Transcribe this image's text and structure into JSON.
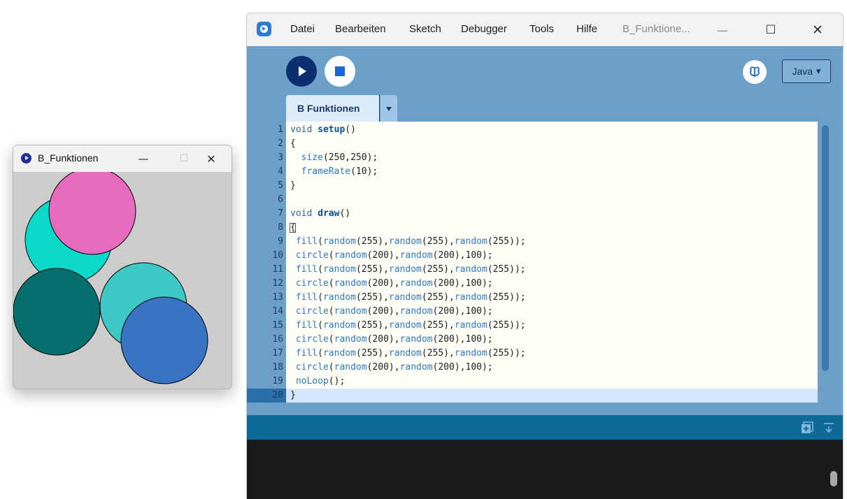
{
  "sketch_window": {
    "title": "B_Funktionen",
    "controls": {
      "minimize": "—",
      "maximize": "☐",
      "close": "✕"
    },
    "circles": [
      {
        "fill": "#0ad9c9"
      },
      {
        "fill": "#e66bbf"
      },
      {
        "fill": "#066f6d"
      },
      {
        "fill": "#3ec8c5"
      },
      {
        "fill": "#3a73c3"
      }
    ],
    "background": "#cccccc"
  },
  "ide": {
    "menu": [
      "Datei",
      "Bearbeiten",
      "Sketch",
      "Debugger",
      "Tools",
      "Hilfe"
    ],
    "window_title": "B_Funktione...",
    "controls": {
      "minimize": "—",
      "maximize": "☐",
      "close": "✕"
    },
    "toolbar": {
      "run_icon": "play-icon",
      "stop_icon": "stop-icon",
      "debug_icon": "butterfly-icon",
      "mode_label": "Java",
      "mode_arrow": "▾"
    },
    "tab": {
      "label": "B Funktionen"
    },
    "editor": {
      "current_line": 20,
      "lines": [
        {
          "num": "1",
          "tokens": [
            [
              "kw",
              "void "
            ],
            [
              "fn",
              "setup"
            ],
            [
              "txt",
              "()"
            ]
          ]
        },
        {
          "num": "2",
          "tokens": [
            [
              "txt",
              "{"
            ]
          ]
        },
        {
          "num": "3",
          "tokens": [
            [
              "txt",
              "  "
            ],
            [
              "call",
              "size"
            ],
            [
              "txt",
              "(250,250);"
            ]
          ]
        },
        {
          "num": "4",
          "tokens": [
            [
              "txt",
              "  "
            ],
            [
              "call",
              "frameRate"
            ],
            [
              "txt",
              "(10);"
            ]
          ]
        },
        {
          "num": "5",
          "tokens": [
            [
              "txt",
              "}"
            ]
          ]
        },
        {
          "num": "6",
          "tokens": []
        },
        {
          "num": "7",
          "tokens": [
            [
              "kw",
              "void "
            ],
            [
              "fn",
              "draw"
            ],
            [
              "txt",
              "()"
            ]
          ]
        },
        {
          "num": "8",
          "tokens": [
            [
              "txt",
              "{"
            ]
          ]
        },
        {
          "num": "9",
          "tokens": [
            [
              "txt",
              " "
            ],
            [
              "call",
              "fill"
            ],
            [
              "txt",
              "("
            ],
            [
              "call",
              "random"
            ],
            [
              "txt",
              "(255),"
            ],
            [
              "call",
              "random"
            ],
            [
              "txt",
              "(255),"
            ],
            [
              "call",
              "random"
            ],
            [
              "txt",
              "(255));"
            ]
          ]
        },
        {
          "num": "10",
          "tokens": [
            [
              "txt",
              " "
            ],
            [
              "call",
              "circle"
            ],
            [
              "txt",
              "("
            ],
            [
              "call",
              "random"
            ],
            [
              "txt",
              "(200),"
            ],
            [
              "call",
              "random"
            ],
            [
              "txt",
              "(200),100);"
            ]
          ]
        },
        {
          "num": "11",
          "tokens": [
            [
              "txt",
              " "
            ],
            [
              "call",
              "fill"
            ],
            [
              "txt",
              "("
            ],
            [
              "call",
              "random"
            ],
            [
              "txt",
              "(255),"
            ],
            [
              "call",
              "random"
            ],
            [
              "txt",
              "(255),"
            ],
            [
              "call",
              "random"
            ],
            [
              "txt",
              "(255));"
            ]
          ]
        },
        {
          "num": "12",
          "tokens": [
            [
              "txt",
              " "
            ],
            [
              "call",
              "circle"
            ],
            [
              "txt",
              "("
            ],
            [
              "call",
              "random"
            ],
            [
              "txt",
              "(200),"
            ],
            [
              "call",
              "random"
            ],
            [
              "txt",
              "(200),100);"
            ]
          ]
        },
        {
          "num": "13",
          "tokens": [
            [
              "txt",
              " "
            ],
            [
              "call",
              "fill"
            ],
            [
              "txt",
              "("
            ],
            [
              "call",
              "random"
            ],
            [
              "txt",
              "(255),"
            ],
            [
              "call",
              "random"
            ],
            [
              "txt",
              "(255),"
            ],
            [
              "call",
              "random"
            ],
            [
              "txt",
              "(255));"
            ]
          ]
        },
        {
          "num": "14",
          "tokens": [
            [
              "txt",
              " "
            ],
            [
              "call",
              "circle"
            ],
            [
              "txt",
              "("
            ],
            [
              "call",
              "random"
            ],
            [
              "txt",
              "(200),"
            ],
            [
              "call",
              "random"
            ],
            [
              "txt",
              "(200),100);"
            ]
          ]
        },
        {
          "num": "15",
          "tokens": [
            [
              "txt",
              " "
            ],
            [
              "call",
              "fill"
            ],
            [
              "txt",
              "("
            ],
            [
              "call",
              "random"
            ],
            [
              "txt",
              "(255),"
            ],
            [
              "call",
              "random"
            ],
            [
              "txt",
              "(255),"
            ],
            [
              "call",
              "random"
            ],
            [
              "txt",
              "(255));"
            ]
          ]
        },
        {
          "num": "16",
          "tokens": [
            [
              "txt",
              " "
            ],
            [
              "call",
              "circle"
            ],
            [
              "txt",
              "("
            ],
            [
              "call",
              "random"
            ],
            [
              "txt",
              "(200),"
            ],
            [
              "call",
              "random"
            ],
            [
              "txt",
              "(200),100);"
            ]
          ]
        },
        {
          "num": "17",
          "tokens": [
            [
              "txt",
              " "
            ],
            [
              "call",
              "fill"
            ],
            [
              "txt",
              "("
            ],
            [
              "call",
              "random"
            ],
            [
              "txt",
              "(255),"
            ],
            [
              "call",
              "random"
            ],
            [
              "txt",
              "(255),"
            ],
            [
              "call",
              "random"
            ],
            [
              "txt",
              "(255));"
            ]
          ]
        },
        {
          "num": "18",
          "tokens": [
            [
              "txt",
              " "
            ],
            [
              "call",
              "circle"
            ],
            [
              "txt",
              "("
            ],
            [
              "call",
              "random"
            ],
            [
              "txt",
              "(200),"
            ],
            [
              "call",
              "random"
            ],
            [
              "txt",
              "(200),100);"
            ]
          ]
        },
        {
          "num": "19",
          "tokens": [
            [
              "txt",
              " "
            ],
            [
              "call",
              "noLoop"
            ],
            [
              "txt",
              "();"
            ]
          ]
        },
        {
          "num": "20",
          "tokens": [
            [
              "txt",
              "}"
            ]
          ]
        }
      ]
    },
    "console": {
      "icons": [
        "add-console-icon",
        "scroll-down-icon"
      ]
    },
    "colors": {
      "accent": "#6da0c8",
      "run": "#0b2f6f",
      "status_bar": "#0e6b99",
      "console": "#1a1a1a",
      "editor_bg": "#fffff7"
    }
  }
}
